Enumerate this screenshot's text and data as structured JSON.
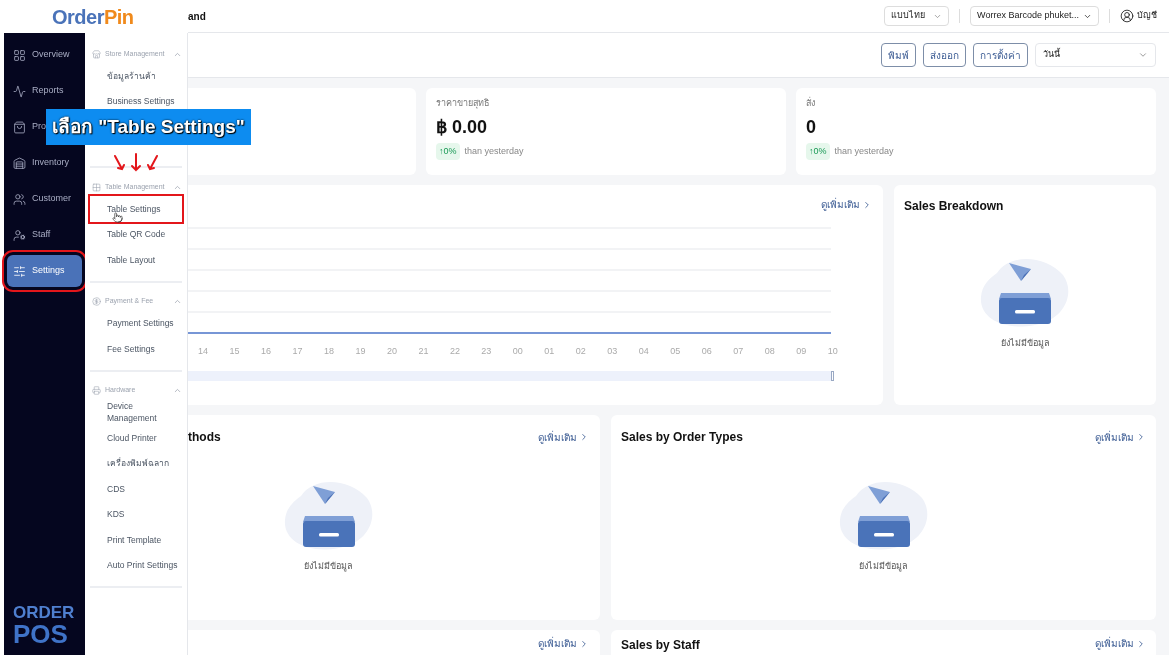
{
  "logo": {
    "first": "Order",
    "second": "Pin"
  },
  "nav": [
    {
      "label": "Overview",
      "selected": false,
      "highlighted": false
    },
    {
      "label": "Reports",
      "selected": false,
      "highlighted": false
    },
    {
      "label": "Pro",
      "selected": false,
      "highlighted": false
    },
    {
      "label": "Inventory",
      "selected": false,
      "highlighted": false
    },
    {
      "label": "Customer",
      "selected": false,
      "highlighted": false
    },
    {
      "label": "Staff",
      "selected": false,
      "highlighted": false
    },
    {
      "label": "Settings",
      "selected": true,
      "highlighted": true
    }
  ],
  "brand_footer": {
    "line1": "ORDER",
    "line2": "POS"
  },
  "submenu": [
    {
      "title": "Store Management",
      "expanded": true,
      "items": [
        {
          "label": "ข้อมูลร้านค้า",
          "highlighted": false
        },
        {
          "label": "Business Settings",
          "highlighted": false
        }
      ]
    },
    {
      "title": "Table Management",
      "expanded": true,
      "items": [
        {
          "label": "Table Settings",
          "highlighted": true
        },
        {
          "label": "Table QR Code",
          "highlighted": false
        },
        {
          "label": "Table Layout",
          "highlighted": false
        }
      ]
    },
    {
      "title": "Payment & Fee",
      "expanded": true,
      "items": [
        {
          "label": "Payment Settings",
          "highlighted": false
        },
        {
          "label": "Fee Settings",
          "highlighted": false
        }
      ]
    },
    {
      "title": "Hardware",
      "expanded": true,
      "items": [
        {
          "label": "Device Management",
          "highlighted": false
        },
        {
          "label": "Cloud Printer",
          "highlighted": false
        },
        {
          "label": "เครื่องพิมพ์ฉลาก",
          "highlighted": false
        },
        {
          "label": "CDS",
          "highlighted": false
        },
        {
          "label": "KDS",
          "highlighted": false
        },
        {
          "label": "Print Template",
          "highlighted": false
        },
        {
          "label": "Auto Print Settings",
          "highlighted": false
        }
      ]
    }
  ],
  "header": {
    "page_title": "and",
    "language": "แบบไทย",
    "store": "Worrex Barcode phuket...",
    "account": "บัญชี"
  },
  "toolbar": {
    "buttons": [
      "พิมพ์",
      "ส่งออก",
      "การตั้งค่า"
    ],
    "period": "วันนี้"
  },
  "stats": [
    {
      "label": "ราคาขายสุทธิ",
      "value": "฿ 0.00",
      "change": "↑0%",
      "compare": "than yesterday"
    },
    {
      "label": "สั่ง",
      "value": "0",
      "change": "↑0%",
      "compare": "than yesterday"
    }
  ],
  "chart_card": {
    "link": "ดูเพิ่มเติม",
    "zoom": {
      "level": 1
    },
    "hours": [
      "14",
      "15",
      "16",
      "17",
      "18",
      "19",
      "20",
      "21",
      "22",
      "23",
      "00",
      "01",
      "02",
      "03",
      "04",
      "05",
      "06",
      "07",
      "08",
      "09",
      "10"
    ]
  },
  "breakdown": {
    "title": "Sales Breakdown",
    "empty": "ยังไม่มีข้อมูล"
  },
  "panels": [
    {
      "title": "thods",
      "link": "ดูเพิ่มเติม",
      "empty": "ยังไม่มีข้อมูล"
    },
    {
      "title": "Sales by Order Types",
      "link": "ดูเพิ่มเติม",
      "empty": "ยังไม่มีข้อมูล"
    }
  ],
  "bottom_panels": [
    {
      "link": "ดูเพิ่มเติม"
    },
    {
      "title": "Sales by Staff",
      "link": "ดูเพิ่มเติม"
    }
  ],
  "overlay": {
    "callout": "เลือก \"Table Settings\""
  }
}
